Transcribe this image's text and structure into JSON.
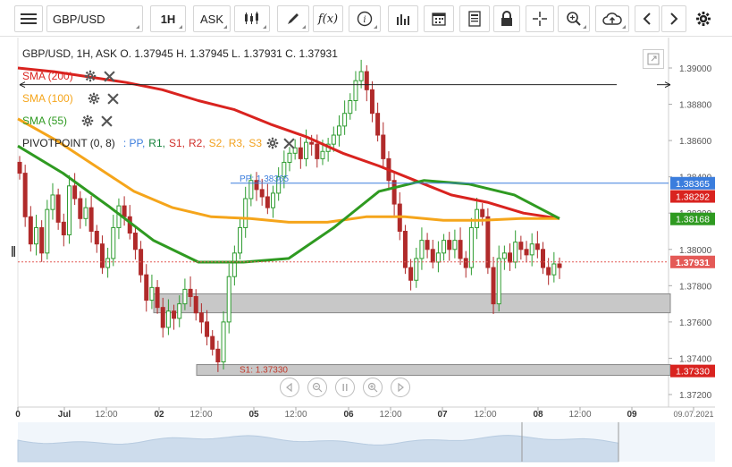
{
  "toolbar": {
    "symbol": "GBP/USD",
    "timeframe": "1H",
    "price_type": "ASK",
    "fx_label": "f(x)",
    "info_label": "i"
  },
  "header": {
    "ohlc": "GBP/USD, 1H, ASK   O. 1.37945 H. 1.37945 L. 1.37931 C. 1.37931"
  },
  "legend": {
    "sma200": "SMA (200)",
    "sma100": "SMA (100)",
    "sma55": "SMA (55)",
    "pivot_prefix": "PIVOTPOINT (0, 8)",
    "pivot_items": [
      {
        "label": ": PP,",
        "color": "#3b7ddd"
      },
      {
        "label": "R1,",
        "color": "#14803a"
      },
      {
        "label": "S1,",
        "color": "#d0302a"
      },
      {
        "label": "R2,",
        "color": "#d0302a"
      },
      {
        "label": "S2,",
        "color": "#f2a11e"
      },
      {
        "label": "R3,",
        "color": "#f2a11e"
      },
      {
        "label": "S3",
        "color": "#f2a11e"
      }
    ]
  },
  "colors": {
    "sma200": "#d9231f",
    "sma100": "#f5a51b",
    "sma55": "#2f9a21",
    "pp": "#3b7ddd",
    "s1": "#333333",
    "last_price": "#e45a57",
    "candle": "#b02a2a",
    "candle_up": "#2e9c30"
  },
  "chart_data": {
    "type": "candlestick",
    "symbol": "GBP/USD",
    "timeframe": "1H",
    "ylim": [
      1.372,
      1.3905
    ],
    "y_ticks": [
      "1.39000",
      "1.38800",
      "1.38600",
      "1.38400",
      "1.38200",
      "1.38000",
      "1.37800",
      "1.37600",
      "1.37400",
      "1.37200"
    ],
    "x_ticks": [
      "0",
      "Jul",
      "12:00",
      "02",
      "12:00",
      "05",
      "12:00",
      "06",
      "12:00",
      "07",
      "12:00",
      "08",
      "12:00",
      "09",
      "09.07.2021"
    ],
    "price_tags": [
      {
        "label": "1.38365",
        "value": 1.38365,
        "color": "#3b7ddd"
      },
      {
        "label": "1.38292",
        "value": 1.38292,
        "color": "#d9231f"
      },
      {
        "label": "1.38168",
        "value": 1.38168,
        "color": "#2f9a21"
      },
      {
        "label": "1.37931",
        "value": 1.37931,
        "color": "#e45a57"
      },
      {
        "label": "1.37330",
        "value": 1.3733,
        "color": "#d9231f"
      }
    ],
    "pivot_labels": [
      {
        "label": "PP: 1.38365",
        "value": 1.38365
      },
      {
        "label": "S1: 1.37330",
        "value": 1.3733
      }
    ],
    "candles_close": [
      1.3842,
      1.3818,
      1.3803,
      1.3812,
      1.3798,
      1.3822,
      1.383,
      1.3815,
      1.3808,
      1.3835,
      1.3828,
      1.3817,
      1.3823,
      1.381,
      1.3803,
      1.379,
      1.3795,
      1.3812,
      1.3824,
      1.3818,
      1.3809,
      1.38,
      1.3786,
      1.3772,
      1.3779,
      1.3768,
      1.3757,
      1.3766,
      1.3762,
      1.377,
      1.3778,
      1.3774,
      1.3765,
      1.376,
      1.3752,
      1.3745,
      1.3738,
      1.376,
      1.3785,
      1.3798,
      1.3812,
      1.3828,
      1.3838,
      1.3833,
      1.3829,
      1.3823,
      1.3831,
      1.384,
      1.3848,
      1.3853,
      1.3856,
      1.385,
      1.3859,
      1.3858,
      1.385,
      1.3854,
      1.3858,
      1.3863,
      1.3868,
      1.3875,
      1.3882,
      1.3893,
      1.3898,
      1.3888,
      1.3875,
      1.3863,
      1.385,
      1.3838,
      1.3825,
      1.381,
      1.379,
      1.3783,
      1.3795,
      1.3805,
      1.38,
      1.3793,
      1.3798,
      1.3805,
      1.38,
      1.3805,
      1.3795,
      1.379,
      1.3812,
      1.3822,
      1.3818,
      1.379,
      1.377,
      1.3795,
      1.3798,
      1.3793,
      1.3804,
      1.38,
      1.3797,
      1.3803,
      1.38,
      1.379,
      1.3786,
      1.3792,
      1.379
    ],
    "sma200": [
      1.39,
      1.3898,
      1.3895,
      1.3892,
      1.3888,
      1.3882,
      1.3877,
      1.3869,
      1.3862,
      1.3853,
      1.3846,
      1.3838,
      1.383,
      1.3826,
      1.382,
      1.3817
    ],
    "sma100": [
      1.3872,
      1.386,
      1.3846,
      1.3832,
      1.3823,
      1.3818,
      1.3817,
      1.3815,
      1.3815,
      1.3818,
      1.3818,
      1.3816,
      1.3816,
      1.3817,
      1.3817
    ],
    "sma55": [
      1.3857,
      1.3842,
      1.3824,
      1.3805,
      1.3793,
      1.3793,
      1.3795,
      1.3812,
      1.3832,
      1.3838,
      1.3836,
      1.383,
      1.3817
    ]
  },
  "navigator": {
    "btn_back": "back",
    "btn_zoom_out": "zoom-out",
    "btn_pause": "pause",
    "btn_zoom_in": "zoom-in",
    "btn_forward": "forward"
  }
}
